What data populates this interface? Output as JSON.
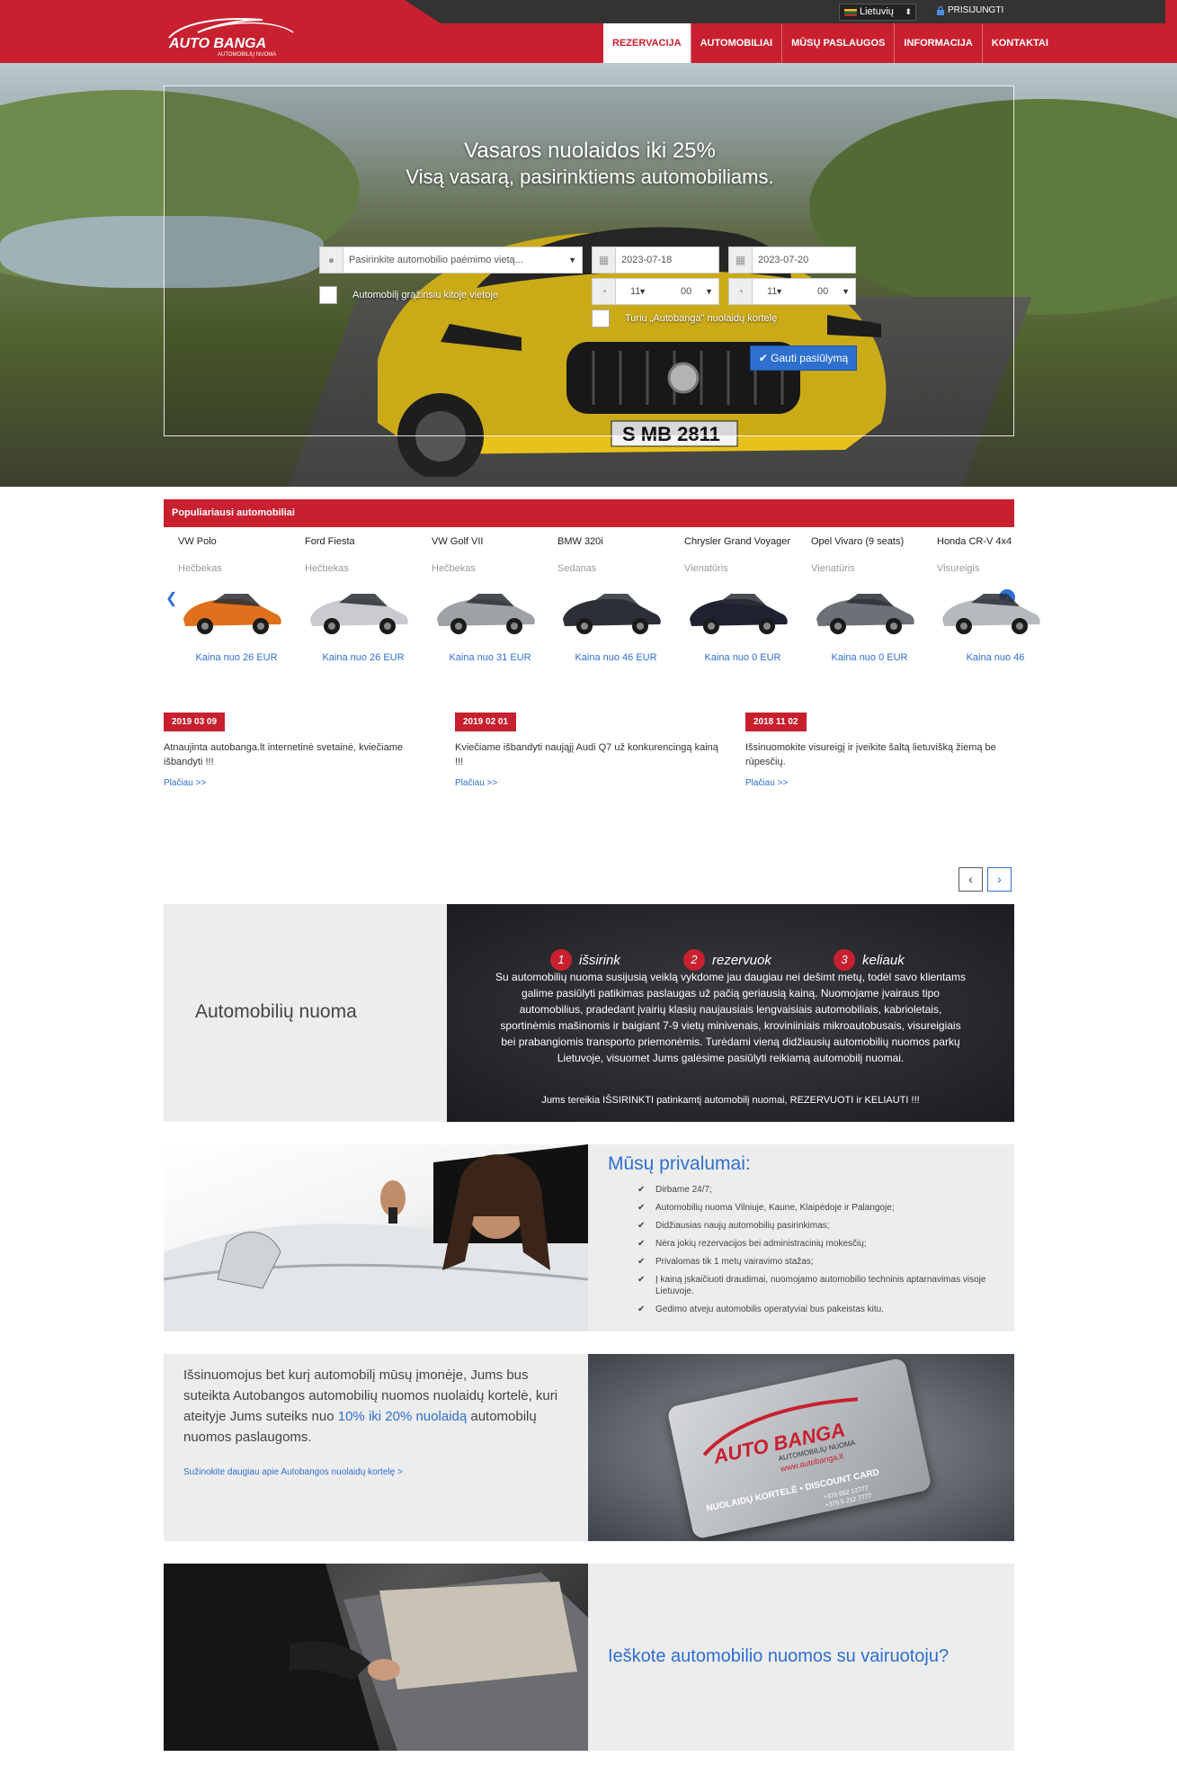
{
  "header": {
    "language": "Lietuvių",
    "login_label": "PRISIJUNGTI",
    "logo_main": "AUTO BANGA",
    "logo_sub": "AUTOMOBILIŲ NUOMA",
    "nav": [
      "REZERVACIJA",
      "AUTOMOBILIAI",
      "MŪSŲ PASLAUGOS",
      "INFORMACIJA",
      "KONTAKTAI"
    ],
    "active_nav": "REZERVACIJA",
    "brand_color": "#c8202f"
  },
  "hero": {
    "title": "Vasaros nuolaidos iki 25%",
    "subtitle": "Visą vasarą, pasirinktiems automobiliams.",
    "location_placeholder": "Pasirinkite automobilio paėmimo vietą...",
    "pickup_date": "2023-07-18",
    "return_date": "2023-07-20",
    "pickup_hour": "11",
    "pickup_minute": "00",
    "return_hour": "11",
    "return_minute": "00",
    "return_elsewhere_label": "Automobilį grąžinsiu kitoje vietoje",
    "discount_card_label": "Turiu „Autobanga\" nuolaidų kortelę",
    "submit_label": "Gauti pasiūlymą",
    "plate_text": "S MB 2811"
  },
  "popular": {
    "heading": "Populiariausi automobiliai",
    "cars": [
      {
        "name": "VW Polo",
        "type": "Hečbekas",
        "price": "Kaina nuo 26 EUR",
        "color": "#e0701c"
      },
      {
        "name": "Ford Fiesta",
        "type": "Hečbekas",
        "price": "Kaina nuo 26 EUR",
        "color": "#c9cbce"
      },
      {
        "name": "VW Golf VII",
        "type": "Hečbekas",
        "price": "Kaina nuo 31 EUR",
        "color": "#9ea1a5"
      },
      {
        "name": "BMW 320i",
        "type": "Sedanas",
        "price": "Kaina nuo 46 EUR",
        "color": "#2c2f36"
      },
      {
        "name": "Chrysler Grand Voyager",
        "type": "Vienatūris",
        "price": "Kaina nuo 0 EUR",
        "color": "#1f2230"
      },
      {
        "name": "Opel Vivaro (9 seats)",
        "type": "Vienatūris",
        "price": "Kaina nuo 0 EUR",
        "color": "#6d7076"
      },
      {
        "name": "Honda CR-V 4x4",
        "type": "Visureigis",
        "price": "Kaina nuo 46",
        "color": "#b6b9bd"
      }
    ]
  },
  "news": [
    {
      "date": "2019 03 09",
      "text": "Atnaujinta autobanga.lt internetinė svetainė, kviečiame išbandyti !!!",
      "more": "Plačiau >>"
    },
    {
      "date": "2019 02 01",
      "text": "Kviečiame išbandyti naująjį Audi Q7 už konkurencingą kainą !!!",
      "more": "Plačiau >>"
    },
    {
      "date": "2018 11 02",
      "text": "Išsinuomokite visureigį ir įveikite šaltą lietuvišką žiemą be rūpesčių.",
      "more": "Plačiau >>"
    }
  ],
  "about": {
    "title": "Automobilių nuoma",
    "steps": [
      "išsirink",
      "rezervuok",
      "keliauk"
    ],
    "text": "Su automobilių nuoma susijusią veiklą vykdome jau daugiau nei dešimt metų, todėl savo klientams galime pasiūlyti patikimas paslaugas už pačią geriausią kainą. Nuomojame įvairaus tipo automobilius, pradedant įvairių klasių naujausiais lengvaisiais automobiliais, kabrioletais, sportinėmis mašinomis ir baigiant 7-9 vietų minivenais, kroviniiniais mikroautobusais, visureigiais bei prabangiomis transporto priemonėmis. Turėdami vieną didžiausių automobilių nuomos parkų Lietuvoje, visuomet Jums galėsime pasiūlyti reikiamą automobilį nuomai.",
    "tagline": "Jums tereikia IŠSIRINKTI patinkamtį automobilį nuomai, REZERVUOTI ir KELIAUTI !!!"
  },
  "advantages": {
    "title": "Mūsų privalumai:",
    "items": [
      "Dirbame 24/7;",
      "Automobilių nuoma Vilniuje, Kaune, Klaipėdoje ir Palangoje;",
      "Didžiausias naujų automobilių pasirinkimas;",
      "Nėra jokių rezervacijos bei administracinių mokesčių;",
      "Privalomas tik 1 metų vairavimo stažas;",
      "Į kainą įskaičiuoti draudimai, nuomojamo automobilio techninis aptarnavimas visoje Lietuvoje.",
      "Gedimo atveju automobilis operatyviai bus pakeistas kitu."
    ]
  },
  "discount": {
    "text_before": "Išsinuomojus bet kurį automobilį mūsų įmonėje, Jums bus suteikta Autobangos automobilių nuomos nuolaidų kortelė, kuri ateityje Jums suteiks nuo ",
    "highlight": "10% iki 20% nuolaidą",
    "text_after": " automobilų nuomos paslaugoms.",
    "link": "Sužinokite daugiau apie Autobangos nuolaidų kortelę >",
    "card_brand": "AUTO BANGA",
    "card_sub": "AUTOMOBILIŲ NUOMA",
    "card_url": "www.autobanga.lt",
    "card_label": "NUOLAIDŲ KORTELĖ • DISCOUNT CARD",
    "card_phone1": "+370 652 12777",
    "card_phone2": "+370 5 212 7777"
  },
  "driver": {
    "title": "Ieškote automobilio nuomos su vairuotoju?"
  },
  "pager": {
    "prev": "‹",
    "next": "›"
  }
}
